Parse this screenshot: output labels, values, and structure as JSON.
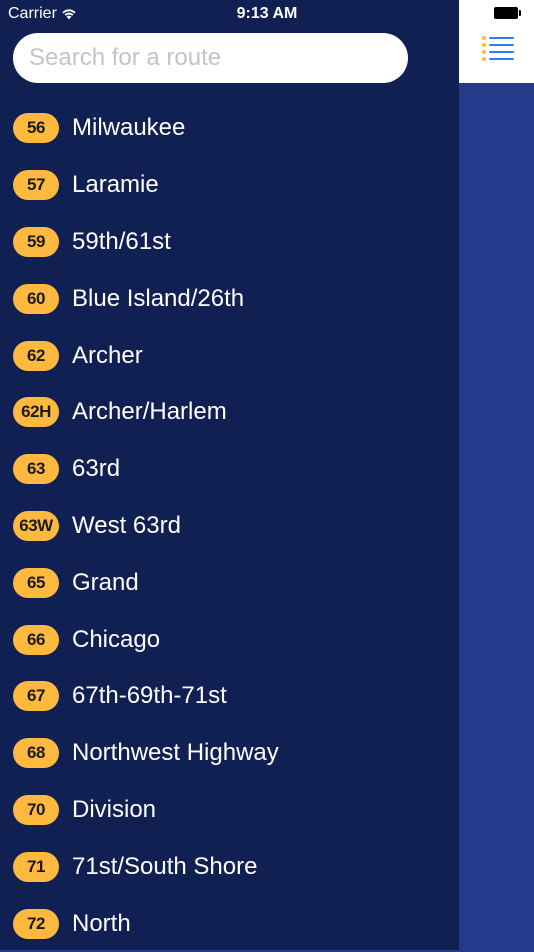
{
  "status_bar": {
    "carrier": "Carrier",
    "time": "9:13 AM"
  },
  "search": {
    "placeholder": "Search for a route"
  },
  "colors": {
    "drawer_bg": "#112052",
    "main_bg": "#233b8a",
    "badge": "#ffb93f",
    "menu_icon": "#2f7df6"
  },
  "routes": [
    {
      "number": "56",
      "name": "Milwaukee"
    },
    {
      "number": "57",
      "name": "Laramie"
    },
    {
      "number": "59",
      "name": "59th/61st"
    },
    {
      "number": "60",
      "name": "Blue Island/26th"
    },
    {
      "number": "62",
      "name": "Archer"
    },
    {
      "number": "62H",
      "name": "Archer/Harlem"
    },
    {
      "number": "63",
      "name": "63rd"
    },
    {
      "number": "63W",
      "name": "West 63rd"
    },
    {
      "number": "65",
      "name": "Grand"
    },
    {
      "number": "66",
      "name": "Chicago"
    },
    {
      "number": "67",
      "name": "67th-69th-71st"
    },
    {
      "number": "68",
      "name": "Northwest Highway"
    },
    {
      "number": "70",
      "name": "Division"
    },
    {
      "number": "71",
      "name": "71st/South Shore"
    },
    {
      "number": "72",
      "name": "North"
    }
  ]
}
